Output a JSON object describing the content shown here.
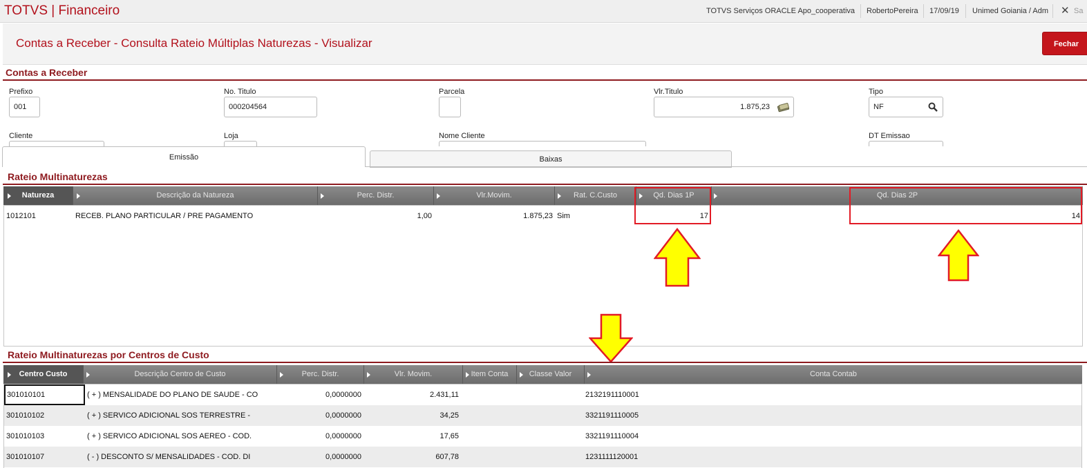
{
  "topbar": {
    "app_title": "TOTVS | Financeiro",
    "environment": "TOTVS Serviços ORACLE Apo_cooperativa",
    "user": "RobertoPereira",
    "date": "17/09/19",
    "branch": "Unimed Goiania / Adm",
    "close_icon": "close-icon",
    "sair_label": "Sa"
  },
  "header": {
    "page_title": "Contas a Receber - Consulta Rateio Múltiplas Naturezas - Visualizar",
    "close_button": "Fechar"
  },
  "contas_receber": {
    "section_title": "Contas a Receber",
    "fields": {
      "prefixo": {
        "label": "Prefixo",
        "value": "001"
      },
      "no_titulo": {
        "label": "No. Titulo",
        "value": "000204564"
      },
      "parcela": {
        "label": "Parcela",
        "value": ""
      },
      "vlr_titulo": {
        "label": "Vlr.Titulo",
        "value": "1.875,23"
      },
      "tipo": {
        "label": "Tipo",
        "value": "NF"
      },
      "cliente": {
        "label": "Cliente"
      },
      "loja": {
        "label": "Loja"
      },
      "nome_cliente": {
        "label": "Nome Cliente"
      },
      "dt_emissao": {
        "label": "DT Emissao"
      }
    }
  },
  "tabs": [
    {
      "label": "Emissão",
      "active": true
    },
    {
      "label": "Baixas",
      "active": false
    }
  ],
  "rateio": {
    "section_title": "Rateio Multinaturezas",
    "columns": [
      "Natureza",
      "Descrição da Natureza",
      "Perc. Distr.",
      "Vlr.Movim.",
      "Rat. C.Custo",
      "Qd. Dias 1P",
      "Qd. Dias 2P"
    ],
    "rows": [
      [
        "1012101",
        "RECEB. PLANO PARTICULAR / PRE PAGAMENTO",
        "1,00",
        "1.875,23",
        "Sim",
        "17",
        "14"
      ]
    ]
  },
  "centros": {
    "section_title": "Rateio Multinaturezas por Centros de Custo",
    "columns": [
      "Centro Custo",
      "Descrição Centro de Custo",
      "Perc. Distr.",
      "Vlr. Movim.",
      "Item Conta",
      "Classe Valor",
      "Conta Contab"
    ],
    "rows": [
      [
        "301010101",
        "( + ) MENSALIDADE DO PLANO DE SAUDE - CO",
        "0,0000000",
        "2.431,11",
        "",
        "",
        "2132191110001"
      ],
      [
        "301010102",
        "( + ) SERVICO ADICIONAL SOS TERRESTRE -",
        "0,0000000",
        "34,25",
        "",
        "",
        "3321191110005"
      ],
      [
        "301010103",
        "( + ) SERVICO ADICIONAL SOS AEREO - COD.",
        "0,0000000",
        "17,65",
        "",
        "",
        "3321191110004"
      ],
      [
        "301010107",
        "( - ) DESCONTO S/ MENSALIDADES - COD. DI",
        "0,0000000",
        "607,78",
        "",
        "",
        "1231111120001"
      ]
    ]
  },
  "annotation_colors": {
    "box": "#e21b25",
    "arrow_fill": "#ffff00",
    "arrow_stroke": "#e21b25"
  }
}
